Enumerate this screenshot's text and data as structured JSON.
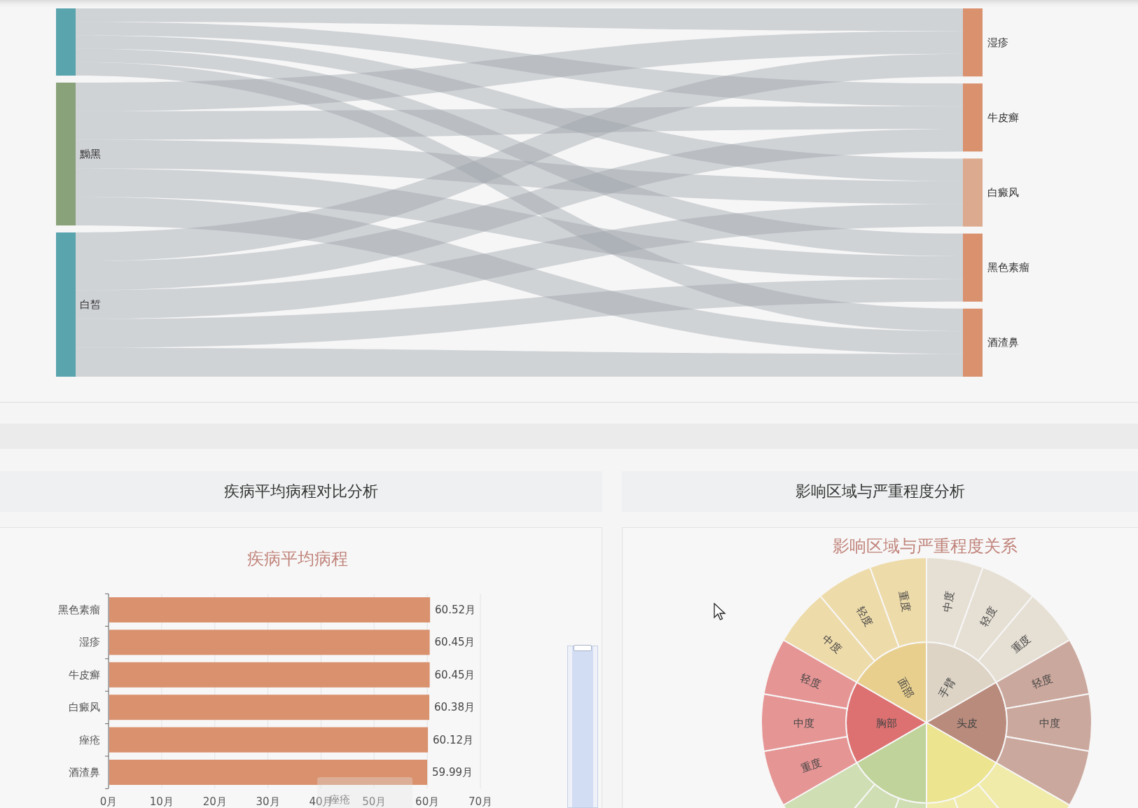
{
  "sankey": {
    "left_nodes": [
      {
        "color": "#5aa4ae"
      },
      {
        "label": "黝黑",
        "color": "#8aa27a"
      },
      {
        "label": "白皙",
        "color": "#5aa4ae"
      }
    ],
    "right_nodes": [
      {
        "label": "湿疹",
        "color": "#d9916e"
      },
      {
        "label": "牛皮癣",
        "color": "#d9916e"
      },
      {
        "label": "白癜风",
        "color": "#dcaa8e"
      },
      {
        "label": "黑色素瘤",
        "color": "#d9916e"
      },
      {
        "label": "酒渣鼻",
        "color": "#d9916e"
      }
    ]
  },
  "panels": [
    {
      "header": "疾病平均病程对比分析",
      "chart_data": {
        "type": "bar",
        "title": "疾病平均病程",
        "orientation": "horizontal",
        "grid": true,
        "categories": [
          "黑色素瘤",
          "湿疹",
          "牛皮癣",
          "白癜风",
          "痤疮",
          "酒渣鼻"
        ],
        "values": [
          60.52,
          60.45,
          60.45,
          60.38,
          60.12,
          59.99
        ],
        "value_labels": [
          "60.52月",
          "60.45月",
          "60.45月",
          "60.38月",
          "60.12月",
          "59.99月"
        ],
        "xlim": [
          0,
          70
        ],
        "xticks": [
          {
            "value": 0,
            "label": "0月"
          },
          {
            "value": 10,
            "label": "10月"
          },
          {
            "value": 20,
            "label": "20月"
          },
          {
            "value": 30,
            "label": "30月"
          },
          {
            "value": 40,
            "label": "40月"
          },
          {
            "value": 50,
            "label": "50月"
          },
          {
            "value": 60,
            "label": "60月"
          },
          {
            "value": 70,
            "label": "70月"
          }
        ]
      },
      "tooltip": "痤疮",
      "zoom_slider": {
        "level": 1
      }
    },
    {
      "header": "影响区域与严重程度分析",
      "sunburst": {
        "title": "影响区域与严重程度关系",
        "regions": [
          {
            "name": "胸部",
            "color": "#dd7171",
            "children": [
              {
                "kind": "segment",
                "name": "重度"
              },
              {
                "kind": "segment",
                "name": "中度"
              },
              {
                "kind": "segment",
                "name": "轻度"
              }
            ]
          },
          {
            "name": "面部",
            "color": "#e8cf8e",
            "children": [
              {
                "kind": "segment",
                "name": "中度"
              },
              {
                "kind": "segment",
                "name": "轻度"
              },
              {
                "kind": "segment",
                "name": "重度"
              }
            ]
          },
          {
            "name": "手臂",
            "color": "#ddd4c6",
            "children": [
              {
                "kind": "segment",
                "name": "中度"
              },
              {
                "kind": "segment",
                "name": "轻度"
              },
              {
                "kind": "segment",
                "name": "重度"
              }
            ]
          },
          {
            "name": "头皮",
            "color": "#b98b7c",
            "children": [
              {
                "kind": "segment",
                "name": "轻度"
              },
              {
                "kind": "segment",
                "name": "中度"
              },
              {
                "kind": "segment"
              }
            ]
          },
          {
            "color": "#ece48e",
            "children": [
              {
                "kind": "segment"
              },
              {
                "kind": "segment"
              },
              {
                "kind": "segment"
              }
            ]
          },
          {
            "color": "#bfd39a",
            "children": [
              {
                "kind": "segment"
              },
              {
                "kind": "segment"
              },
              {
                "kind": "segment"
              }
            ]
          }
        ]
      }
    }
  ]
}
